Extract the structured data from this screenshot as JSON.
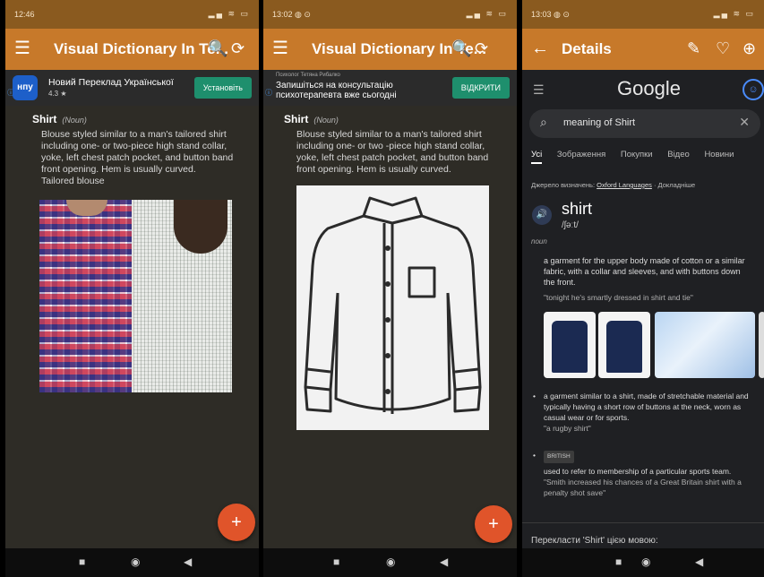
{
  "screen1": {
    "status": {
      "time": "12:46",
      "icons": "▂▄ ≋ ▭"
    },
    "appbar": {
      "title": "Visual Dictionary In Te...",
      "menu_icon": "☰",
      "search_icon": "🔍",
      "history_icon": "⟳"
    },
    "ad": {
      "logo_text": "нпу",
      "text": "Новий Переклад Української",
      "rating": "4.3 ★",
      "cta": "Установіть",
      "info_icon": "ⓘ"
    },
    "entry": {
      "term": "Shirt",
      "pos": "(Noun)",
      "definition": "Blouse styled similar to a man's tailored shirt including one- or two-piece high stand collar, yoke, left chest patch pocket, and button band front opening. Hem is usually curved.",
      "extra": "Tailored blouse"
    },
    "fab": "+"
  },
  "screen2": {
    "status": {
      "time": "13:02 ◍ ⊙",
      "icons": "▂▄ ≋ ▭"
    },
    "appbar": {
      "title": "Visual Dictionary In Te...",
      "menu_icon": "☰",
      "search_icon": "🔍",
      "history_icon": "⟳"
    },
    "ad": {
      "sponsor": "Психолог Тетяна Рибалко",
      "text": "Запишіться на консультацію психотерапевта вже сьогодні",
      "cta": "ВІДКРИТИ",
      "info_icon": "ⓘ"
    },
    "entry": {
      "term": "Shirt",
      "pos": "(Noun)",
      "definition": "Blouse styled similar to a man's tailored shirt including one- or two -piece high stand collar, yoke, left chest patch pocket, and button band front opening. Hem is usually curved."
    },
    "fab": "+"
  },
  "screen3": {
    "status": {
      "time": "13:03 ◍ ⊙",
      "icons": "▂▄ ≋ ▭"
    },
    "appbar": {
      "title": "Details",
      "back_icon": "←",
      "edit_icon": "✎",
      "heart_icon": "♡",
      "more_icon": "⊕"
    },
    "google": {
      "logo": "Google",
      "menu_icon": "☰",
      "search_query": "meaning of Shirt",
      "tabs": [
        "Усі",
        "Зображення",
        "Покупки",
        "Відео",
        "Новини"
      ],
      "source_prefix": "Джерело визначень:",
      "source_link": "Oxford Languages",
      "source_more": "· Докладніше",
      "word": "shirt",
      "phonetic": "/ʃəːt/",
      "pos": "noun",
      "def1": "a garment for the upper body made of cotton or a similar fabric, with a collar and sleeves, and with buttons down the front.",
      "ex1": "\"tonight he's smartly dressed in shirt and tie\"",
      "bullet1": "a garment similar to a shirt, made of stretchable material and typically having a short row of buttons at the neck, worn as casual wear or for sports.",
      "bullet1_ex": "\"a rugby shirt\"",
      "bullet2_tag": "BRITISH",
      "bullet2": "used to refer to membership of a particular sports team.",
      "bullet2_ex": "\"Smith increased his chances of a Great Britain shirt with a penalty shot save\"",
      "translate": "Перекласти 'Shirt' цією мовою:"
    }
  },
  "navbar": {
    "square": "■",
    "circle": "◉",
    "back": "◀"
  }
}
